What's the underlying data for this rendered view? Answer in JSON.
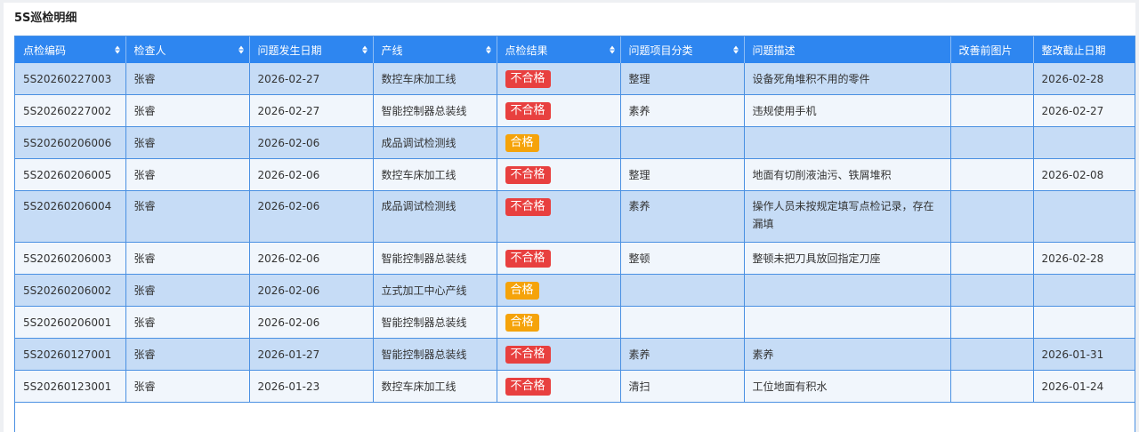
{
  "panel": {
    "title": "5S巡检明细"
  },
  "columns": [
    "点检编码",
    "检查人",
    "问题发生日期",
    "产线",
    "点检结果",
    "问题项目分类",
    "问题描述",
    "改善前图片",
    "整改截止日期"
  ],
  "colors": {
    "header": "#2e86f0",
    "row_odd": "#c6dcf6",
    "row_even": "#f1f6fc",
    "fail": "#e8403f",
    "pass": "#f5a30a"
  },
  "rows": [
    {
      "code": "5S20260227003",
      "inspector": "张睿",
      "date": "2026-02-27",
      "line": "数控车床加工线",
      "result": "不合格",
      "category": "整理",
      "desc": "设备死角堆积不用的零件",
      "image": "",
      "deadline": "2026-02-28"
    },
    {
      "code": "5S20260227002",
      "inspector": "张睿",
      "date": "2026-02-27",
      "line": "智能控制器总装线",
      "result": "不合格",
      "category": "素养",
      "desc": "违规使用手机",
      "image": "",
      "deadline": "2026-02-27"
    },
    {
      "code": "5S20260206006",
      "inspector": "张睿",
      "date": "2026-02-06",
      "line": "成品调试检测线",
      "result": "合格",
      "category": "",
      "desc": "",
      "image": "",
      "deadline": ""
    },
    {
      "code": "5S20260206005",
      "inspector": "张睿",
      "date": "2026-02-06",
      "line": "数控车床加工线",
      "result": "不合格",
      "category": "整理",
      "desc": "地面有切削液油污、铁屑堆积",
      "image": "",
      "deadline": "2026-02-08"
    },
    {
      "code": "5S20260206004",
      "inspector": "张睿",
      "date": "2026-02-06",
      "line": "成品调试检测线",
      "result": "不合格",
      "category": "素养",
      "desc": "操作人员未按规定填写点检记录，存在漏填",
      "image": "",
      "deadline": ""
    },
    {
      "code": "5S20260206003",
      "inspector": "张睿",
      "date": "2026-02-06",
      "line": "智能控制器总装线",
      "result": "不合格",
      "category": "整顿",
      "desc": "整顿未把刀具放回指定刀座",
      "image": "",
      "deadline": "2026-02-28"
    },
    {
      "code": "5S20260206002",
      "inspector": "张睿",
      "date": "2026-02-06",
      "line": "立式加工中心产线",
      "result": "合格",
      "category": "",
      "desc": "",
      "image": "",
      "deadline": ""
    },
    {
      "code": "5S20260206001",
      "inspector": "张睿",
      "date": "2026-02-06",
      "line": "智能控制器总装线",
      "result": "合格",
      "category": "",
      "desc": "",
      "image": "",
      "deadline": ""
    },
    {
      "code": "5S20260127001",
      "inspector": "张睿",
      "date": "2026-01-27",
      "line": "智能控制器总装线",
      "result": "不合格",
      "category": "素养",
      "desc": "素养",
      "image": "",
      "deadline": "2026-01-31"
    },
    {
      "code": "5S20260123001",
      "inspector": "张睿",
      "date": "2026-01-23",
      "line": "数控车床加工线",
      "result": "不合格",
      "category": "清扫",
      "desc": "工位地面有积水",
      "image": "",
      "deadline": "2026-01-24"
    }
  ]
}
